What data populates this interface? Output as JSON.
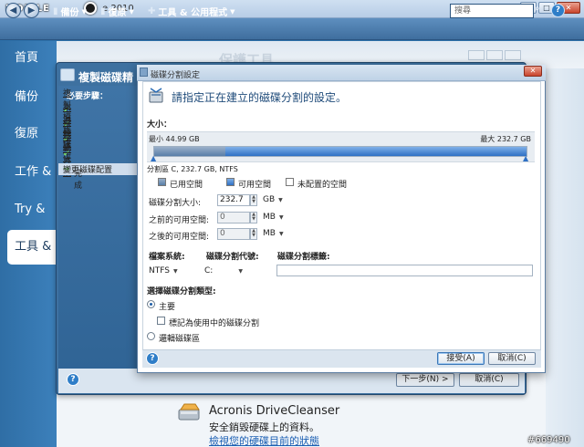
{
  "app": {
    "title_suffix": "e 2010",
    "logo_text": "MOBILE",
    "watermark": "#669490"
  },
  "toolbar": {
    "backup": "備份",
    "recovery": "復原",
    "tools": "工具 & 公用程式",
    "search_placeholder": "搜尋"
  },
  "leftnav": {
    "items": [
      "首頁",
      "備份",
      "復原",
      "工作 &",
      "Try & D",
      "工具 &"
    ]
  },
  "background": {
    "header_title": "保護工具",
    "drivecleaner_title": "Acronis DriveCleanser",
    "drivecleaner_desc": "安全銷毀硬碟上的資料。",
    "drivecleaner_link": "檢視您的硬碟目前的狀態"
  },
  "wizard": {
    "title": "複製磁碟精",
    "steps_heading": "必要步驟：",
    "steps": [
      {
        "label": "複製模式",
        "state": "done"
      },
      {
        "label": "來源磁碟",
        "state": "done"
      },
      {
        "label": "目標磁碟",
        "state": "done"
      },
      {
        "label": "移動方法",
        "state": "done"
      },
      {
        "label": "變更磁碟配置",
        "state": "current"
      },
      {
        "label": "完成",
        "state": "pending"
      }
    ],
    "next_button": "下一步(N) >",
    "cancel_button": "取消(C)"
  },
  "dialog": {
    "title": "磁碟分割設定",
    "heading": "請指定正在建立的磁碟分割的設定。",
    "size_section": "大小：",
    "min_label": "最小 44.99 GB",
    "max_label": "最大 232.7 GB",
    "partition_info": "分割區 C, 232.7 GB, NTFS",
    "bar": {
      "used_fraction": 0.19,
      "fill_fraction": 1.0
    },
    "legend": {
      "used": "已用空間",
      "free": "可用空間",
      "unallocated": "未配置的空間"
    },
    "partition_size_label": "磁碟分割大小:",
    "partition_size_value": "232.7",
    "partition_size_unit": "GB",
    "before_label": "之前的可用空間:",
    "before_value": "0",
    "before_unit": "MB",
    "after_label": "之後的可用空間:",
    "after_value": "0",
    "after_unit": "MB",
    "fs_label": "檔案系統:",
    "fs_value": "NTFS",
    "letter_label": "磁碟分割代號:",
    "letter_value": "C:",
    "volume_label_label": "磁碟分割標籤:",
    "volume_label_value": "",
    "type_section": "選擇磁碟分割類型:",
    "type_primary": "主要",
    "mark_active": "標記為使用中的磁碟分割",
    "type_logical": "邏輯磁碟區",
    "accept_button": "接受(A)",
    "cancel_button": "取消(C)"
  }
}
